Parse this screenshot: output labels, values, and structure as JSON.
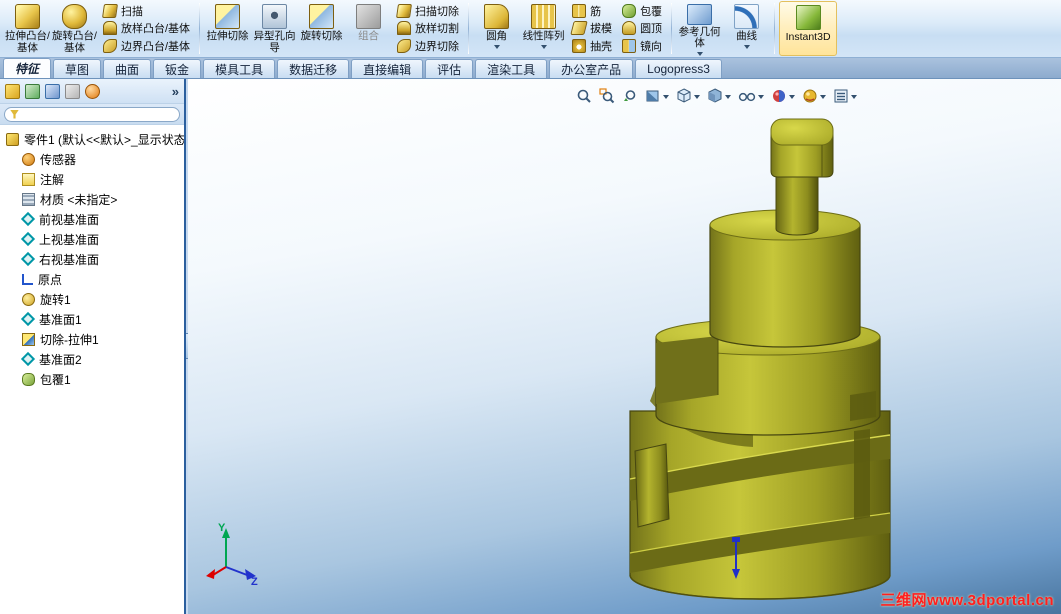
{
  "ribbon": {
    "buttons": [
      {
        "label": "拉伸凸台/基体",
        "type": "large",
        "icon": "extruded-boss"
      },
      {
        "label": "旋转凸台/基体",
        "type": "large",
        "icon": "revolved-boss"
      },
      {
        "label": "扫描",
        "type": "small",
        "icon": "swept-boss"
      },
      {
        "label": "放样凸台/基体",
        "type": "small",
        "icon": "lofted-boss"
      },
      {
        "label": "边界凸台/基体",
        "type": "small",
        "icon": "boundary-boss"
      },
      {
        "label": "拉伸切除",
        "type": "large",
        "icon": "extruded-cut"
      },
      {
        "label": "异型孔向导",
        "type": "large",
        "icon": "hole-wizard"
      },
      {
        "label": "旋转切除",
        "type": "large",
        "icon": "revolved-cut"
      },
      {
        "label": "组合",
        "type": "large",
        "icon": "combine",
        "disabled": true
      },
      {
        "label": "扫描切除",
        "type": "small",
        "icon": "swept-cut"
      },
      {
        "label": "放样切割",
        "type": "small",
        "icon": "lofted-cut"
      },
      {
        "label": "边界切除",
        "type": "small",
        "icon": "boundary-cut"
      },
      {
        "label": "圆角",
        "type": "large",
        "icon": "fillet"
      },
      {
        "label": "线性阵列",
        "type": "large",
        "icon": "linear-pattern"
      },
      {
        "label": "筋",
        "type": "small",
        "icon": "rib"
      },
      {
        "label": "拔模",
        "type": "small",
        "icon": "draft"
      },
      {
        "label": "抽壳",
        "type": "small",
        "icon": "shell"
      },
      {
        "label": "包覆",
        "type": "small",
        "icon": "wrap"
      },
      {
        "label": "圆顶",
        "type": "small",
        "icon": "dome"
      },
      {
        "label": "镜向",
        "type": "small",
        "icon": "mirror"
      },
      {
        "label": "参考几何体",
        "type": "large",
        "icon": "reference-geometry"
      },
      {
        "label": "曲线",
        "type": "large",
        "icon": "curves"
      },
      {
        "label": "Instant3D",
        "type": "large",
        "icon": "instant3d",
        "active": true
      }
    ]
  },
  "tabs": [
    {
      "label": "特征",
      "active": true
    },
    {
      "label": "草图"
    },
    {
      "label": "曲面"
    },
    {
      "label": "钣金"
    },
    {
      "label": "模具工具"
    },
    {
      "label": "数据迁移"
    },
    {
      "label": "直接编辑"
    },
    {
      "label": "评估"
    },
    {
      "label": "渲染工具"
    },
    {
      "label": "办公室产品"
    },
    {
      "label": "Logopress3"
    }
  ],
  "panel": {
    "more": "»"
  },
  "tree": {
    "root": "零件1 (默认<<默认>_显示状态",
    "items": [
      {
        "label": "传感器",
        "icon": "sensors"
      },
      {
        "label": "注解",
        "icon": "annotations"
      },
      {
        "label": "材质 <未指定>",
        "icon": "material"
      },
      {
        "label": "前视基准面",
        "icon": "plane"
      },
      {
        "label": "上视基准面",
        "icon": "plane"
      },
      {
        "label": "右视基准面",
        "icon": "plane"
      },
      {
        "label": "原点",
        "icon": "origin"
      },
      {
        "label": "旋转1",
        "icon": "revolve-feature"
      },
      {
        "label": "基准面1",
        "icon": "plane"
      },
      {
        "label": "切除-拉伸1",
        "icon": "cut-extrude-feature"
      },
      {
        "label": "基准面2",
        "icon": "plane"
      },
      {
        "label": "包覆1",
        "icon": "wrap-feature"
      }
    ]
  },
  "viewport": {
    "watermark": "三维网www.3dportal.cn",
    "triad": {
      "y_label": "Y",
      "z_label": "Z"
    }
  },
  "colors": {
    "model_olive": "#a6a626",
    "viewport_bottom_blue": "#49759f",
    "watermark_red": "#ff1f1f",
    "ribbon_blue": "#c8def3"
  }
}
